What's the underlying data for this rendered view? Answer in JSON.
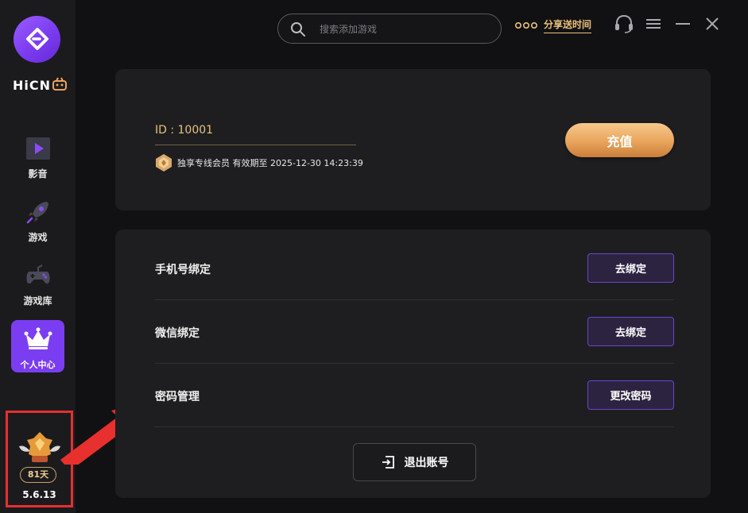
{
  "app": {
    "brand": "HiCN",
    "version": "5.6.13"
  },
  "sidebar": {
    "items": [
      {
        "label": "影音",
        "icon": "play-icon"
      },
      {
        "label": "游戏",
        "icon": "rocket-icon"
      },
      {
        "label": "游戏库",
        "icon": "gamepad-icon"
      },
      {
        "label": "个人中心",
        "icon": "crown-icon",
        "active": true
      }
    ],
    "badge": {
      "days": "81天",
      "icon": "rank-badge-icon"
    }
  },
  "header": {
    "search": {
      "placeholder": "搜索添加游戏",
      "value": ""
    },
    "share_label": "分享送时间",
    "icons": [
      "headset-icon",
      "menu-icon",
      "minimize-icon",
      "close-icon"
    ]
  },
  "account": {
    "id_text": "ID : 10001",
    "membership": "独享专线会员 有效期至 2025-12-30 14:23:39",
    "recharge_label": "充值"
  },
  "bindings": [
    {
      "label": "手机号绑定",
      "button": "去绑定"
    },
    {
      "label": "微信绑定",
      "button": "去绑定"
    },
    {
      "label": "密码管理",
      "button": "更改密码"
    }
  ],
  "logout_label": "退出账号",
  "colors": {
    "accent": "#7b3df2",
    "gold": "#e9c27a",
    "background": "#111113",
    "card": "#1e1e21",
    "highlight": "#e53030"
  }
}
